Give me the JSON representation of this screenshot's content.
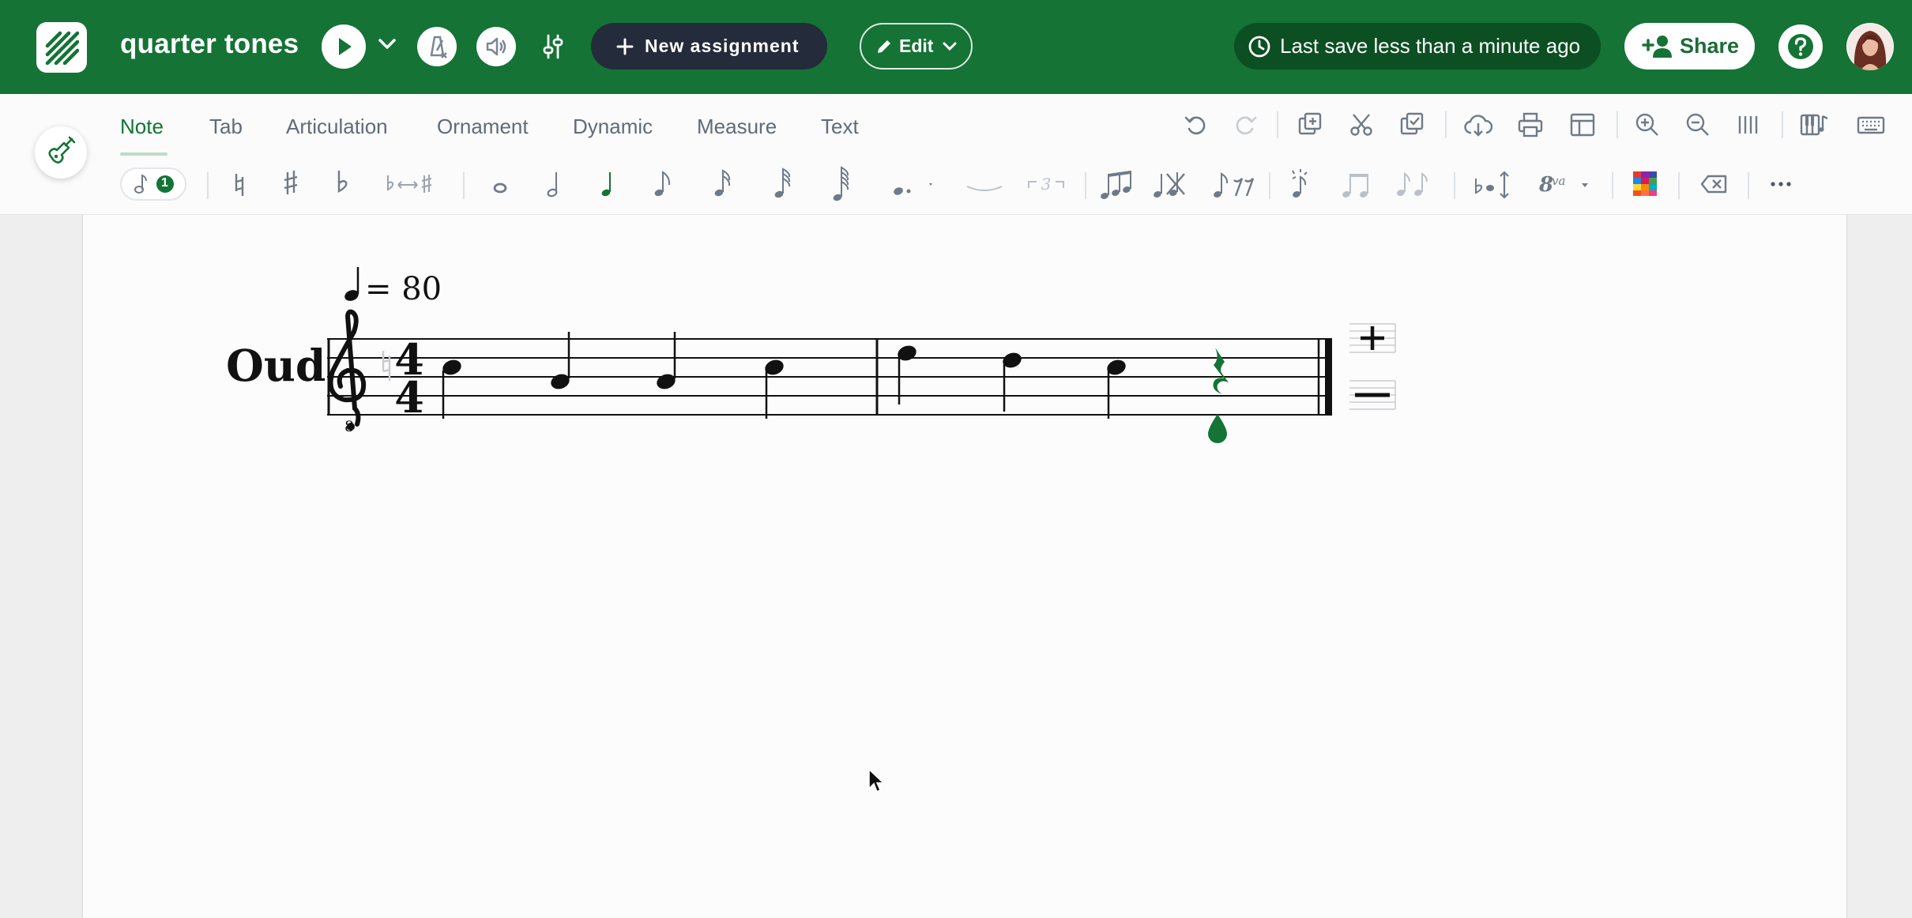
{
  "header": {
    "title": "quarter tones",
    "new_assignment_label": "New assignment",
    "edit_label": "Edit",
    "save_status": "Last save less than a minute ago",
    "share_label": "Share",
    "brand_color": "#147335"
  },
  "tabs": [
    {
      "label": "Note",
      "active": true
    },
    {
      "label": "Tab"
    },
    {
      "label": "Articulation"
    },
    {
      "label": "Ornament"
    },
    {
      "label": "Dynamic"
    },
    {
      "label": "Measure"
    },
    {
      "label": "Text"
    }
  ],
  "toolbar": {
    "voice_count": "1"
  },
  "score": {
    "tempo_value": "= 80",
    "instrument": "Oud",
    "time_signature": {
      "top": "4",
      "bottom": "4"
    },
    "clef": "treble-8vb",
    "measures": [
      [
        "B4",
        "G4",
        "G4",
        "B4"
      ],
      [
        "D5",
        "C5",
        "B4",
        "rest"
      ]
    ]
  }
}
